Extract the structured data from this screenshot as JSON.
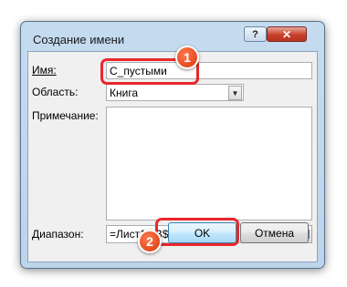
{
  "dialog": {
    "title": "Создание имени",
    "help_label": "?",
    "close_label": "✕"
  },
  "form": {
    "name_label": "Имя:",
    "name_value": "С_пустыми",
    "scope_label": "Область:",
    "scope_value": "Книга",
    "comment_label": "Примечание:",
    "comment_value": "",
    "range_label": "Диапазон:",
    "range_value": "=Лист1!$B$5:$B$10"
  },
  "buttons": {
    "ok_label": "OK",
    "cancel_label": "Отмена"
  },
  "annotations": {
    "step1": "1",
    "step2": "2",
    "highlight_color": "#e8282a",
    "badge_color": "#e54a1c"
  },
  "icons": [
    "dropdown-arrow-icon",
    "range-selector-icon",
    "help-icon",
    "close-icon"
  ]
}
